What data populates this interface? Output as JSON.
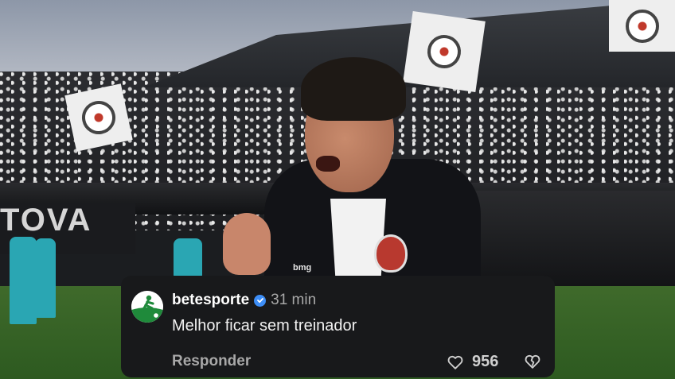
{
  "comment": {
    "username": "betesporte",
    "verified": true,
    "timestamp": "31 min",
    "text": "Melhor ficar sem treinador",
    "reply_label": "Responder",
    "like_count": "956",
    "icons": {
      "avatar": "soccer-player-logo",
      "verified": "verified-badge-icon",
      "like": "heart-icon",
      "dislike": "dislike-icon"
    },
    "colors": {
      "card_background": "#18191b",
      "avatar_green": "#1f8a3b",
      "verified_blue": "#3d8ef7"
    }
  },
  "photo": {
    "banner_text": "TOVA",
    "sponsor_text": "bmg"
  }
}
